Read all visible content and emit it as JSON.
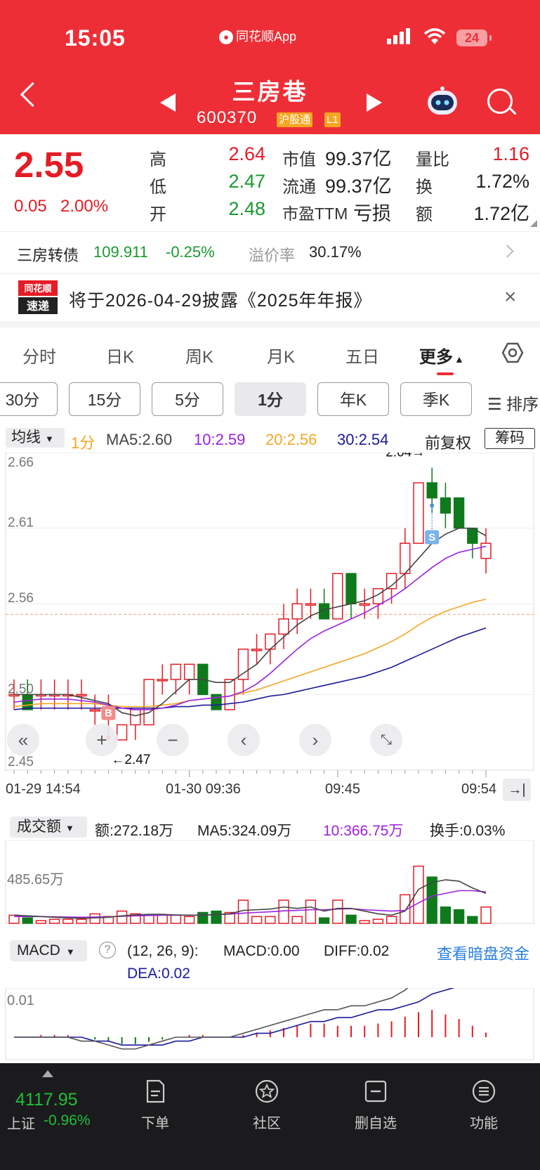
{
  "status": {
    "time": "15:05",
    "app": "同花顺App",
    "battery": "24"
  },
  "stock": {
    "name": "三房巷",
    "code": "600370",
    "tag_market": "沪股通",
    "tag_level": "L1"
  },
  "quote": {
    "price": "2.55",
    "change": "0.05",
    "change_pct": "2.00%",
    "high_label": "高",
    "high": "2.64",
    "low_label": "低",
    "low": "2.47",
    "open_label": "开",
    "open": "2.48",
    "mktcap_label": "市值",
    "mktcap": "99.37亿",
    "float_label": "流通",
    "float": "99.37亿",
    "pe_label": "市盈TTM",
    "pe": "亏损",
    "volratio_label": "量比",
    "volratio": "1.16",
    "turnover_label": "换",
    "turnover": "1.72%",
    "amount_label": "额",
    "amount": "1.72亿"
  },
  "bond": {
    "name": "三房转债",
    "price": "109.911",
    "change": "-0.25%",
    "premium_label": "溢价率",
    "premium": "30.17%"
  },
  "notice": {
    "logo_top": "同花顺",
    "logo_bottom": "速递",
    "text": "将于2026-04-29披露《2025年年报》"
  },
  "tabs": [
    "分时",
    "日K",
    "周K",
    "月K",
    "五日",
    "更多"
  ],
  "periods": [
    "30分",
    "15分",
    "5分",
    "1分",
    "年K",
    "季K"
  ],
  "sort_label": "☰ 排序",
  "ma_row": {
    "selector": "均线",
    "period": "1分",
    "ma5": "MA5:2.60",
    "ma10": "10:2.59",
    "ma20": "20:2.56",
    "ma30": "30:2.54",
    "fq": "前复权",
    "chouma": "筹码"
  },
  "price_axis": [
    "2.66",
    "2.61",
    "2.56",
    "2.50",
    "2.45"
  ],
  "annotations": {
    "high": "2.64→",
    "low": "←2.47",
    "buy": "B",
    "sell": "S"
  },
  "time_axis": [
    "01-29 14:54",
    "01-30 09:36",
    "09:45",
    "09:54"
  ],
  "volume": {
    "selector": "成交额",
    "amount": "额:272.18万",
    "ma5": "MA5:324.09万",
    "ma10": "10:366.75万",
    "turnover": "换手:0.03%",
    "axis_label": "485.65万"
  },
  "macd": {
    "selector": "MACD",
    "params": "(12, 26, 9):",
    "macd": "MACD:0.00",
    "diff": "DIFF:0.02",
    "dea": "DEA:0.02",
    "link": "查看暗盘资金",
    "axis_label": "0.01"
  },
  "bottom": {
    "index_value": "4117.95",
    "index_name": "上证",
    "index_pct": "-0.96%",
    "items": [
      "下单",
      "社区",
      "删自选",
      "功能"
    ]
  },
  "colors": {
    "up": "#e41c25",
    "down": "#0f7a1c",
    "ma5": "#444444",
    "ma10": "#9b22e0",
    "ma20": "#f5a623",
    "ma30": "#1a1a9a",
    "header": "#ee2e36"
  },
  "chart_data": {
    "type": "candlestick",
    "price_range": [
      2.45,
      2.66
    ],
    "candles": [
      {
        "o": 2.5,
        "c": 2.5,
        "h": 2.51,
        "l": 2.49
      },
      {
        "o": 2.5,
        "c": 2.49,
        "h": 2.51,
        "l": 2.49
      },
      {
        "o": 2.5,
        "c": 2.5,
        "h": 2.51,
        "l": 2.49
      },
      {
        "o": 2.5,
        "c": 2.5,
        "h": 2.51,
        "l": 2.49
      },
      {
        "o": 2.5,
        "c": 2.5,
        "h": 2.51,
        "l": 2.49
      },
      {
        "o": 2.5,
        "c": 2.5,
        "h": 2.51,
        "l": 2.49
      },
      {
        "o": 2.49,
        "c": 2.49,
        "h": 2.5,
        "l": 2.48
      },
      {
        "o": 2.49,
        "c": 2.49,
        "h": 2.5,
        "l": 2.47
      },
      {
        "o": 2.47,
        "c": 2.48,
        "h": 2.48,
        "l": 2.47
      },
      {
        "o": 2.48,
        "c": 2.49,
        "h": 2.49,
        "l": 2.47
      },
      {
        "o": 2.48,
        "c": 2.51,
        "h": 2.51,
        "l": 2.48
      },
      {
        "o": 2.51,
        "c": 2.51,
        "h": 2.52,
        "l": 2.5
      },
      {
        "o": 2.51,
        "c": 2.52,
        "h": 2.52,
        "l": 2.5
      },
      {
        "o": 2.51,
        "c": 2.52,
        "h": 2.52,
        "l": 2.5
      },
      {
        "o": 2.52,
        "c": 2.5,
        "h": 2.52,
        "l": 2.5
      },
      {
        "o": 2.5,
        "c": 2.49,
        "h": 2.5,
        "l": 2.49
      },
      {
        "o": 2.49,
        "c": 2.51,
        "h": 2.51,
        "l": 2.49
      },
      {
        "o": 2.51,
        "c": 2.53,
        "h": 2.53,
        "l": 2.5
      },
      {
        "o": 2.53,
        "c": 2.53,
        "h": 2.54,
        "l": 2.52
      },
      {
        "o": 2.53,
        "c": 2.54,
        "h": 2.54,
        "l": 2.52
      },
      {
        "o": 2.54,
        "c": 2.55,
        "h": 2.56,
        "l": 2.53
      },
      {
        "o": 2.55,
        "c": 2.56,
        "h": 2.57,
        "l": 2.54
      },
      {
        "o": 2.56,
        "c": 2.56,
        "h": 2.57,
        "l": 2.55
      },
      {
        "o": 2.56,
        "c": 2.55,
        "h": 2.57,
        "l": 2.55
      },
      {
        "o": 2.55,
        "c": 2.58,
        "h": 2.58,
        "l": 2.55
      },
      {
        "o": 2.58,
        "c": 2.56,
        "h": 2.58,
        "l": 2.55
      },
      {
        "o": 2.56,
        "c": 2.56,
        "h": 2.57,
        "l": 2.55
      },
      {
        "o": 2.56,
        "c": 2.57,
        "h": 2.57,
        "l": 2.55
      },
      {
        "o": 2.57,
        "c": 2.58,
        "h": 2.58,
        "l": 2.56
      },
      {
        "o": 2.58,
        "c": 2.6,
        "h": 2.61,
        "l": 2.57
      },
      {
        "o": 2.6,
        "c": 2.64,
        "h": 2.64,
        "l": 2.6
      },
      {
        "o": 2.64,
        "c": 2.63,
        "h": 2.65,
        "l": 2.62
      },
      {
        "o": 2.63,
        "c": 2.62,
        "h": 2.64,
        "l": 2.61
      },
      {
        "o": 2.63,
        "c": 2.61,
        "h": 2.63,
        "l": 2.61
      },
      {
        "o": 2.61,
        "c": 2.6,
        "h": 2.61,
        "l": 2.59
      },
      {
        "o": 2.59,
        "c": 2.6,
        "h": 2.61,
        "l": 2.58
      }
    ],
    "ma5": [
      2.5,
      2.5,
      2.5,
      2.5,
      2.5,
      2.498,
      2.496,
      2.494,
      2.488,
      2.486,
      2.488,
      2.494,
      2.502,
      2.51,
      2.51,
      2.508,
      2.508,
      2.514,
      2.52,
      2.53,
      2.538,
      2.546,
      2.552,
      2.556,
      2.558,
      2.56,
      2.562,
      2.566,
      2.572,
      2.58,
      2.59,
      2.6,
      2.606,
      2.61,
      2.61,
      2.605
    ],
    "ma10": [
      2.495,
      2.496,
      2.497,
      2.497,
      2.497,
      2.496,
      2.495,
      2.493,
      2.491,
      2.49,
      2.49,
      2.491,
      2.493,
      2.496,
      2.497,
      2.498,
      2.499,
      2.502,
      2.507,
      2.514,
      2.522,
      2.53,
      2.537,
      2.542,
      2.546,
      2.55,
      2.554,
      2.559,
      2.564,
      2.57,
      2.577,
      2.584,
      2.59,
      2.594,
      2.596,
      2.598
    ],
    "ma20": [
      2.492,
      2.493,
      2.494,
      2.494,
      2.494,
      2.494,
      2.494,
      2.493,
      2.492,
      2.492,
      2.492,
      2.493,
      2.494,
      2.496,
      2.497,
      2.498,
      2.499,
      2.501,
      2.503,
      2.506,
      2.509,
      2.512,
      2.515,
      2.518,
      2.521,
      2.524,
      2.527,
      2.531,
      2.535,
      2.54,
      2.546,
      2.551,
      2.555,
      2.558,
      2.561,
      2.563
    ],
    "ma30": [
      2.49,
      2.491,
      2.491,
      2.491,
      2.491,
      2.491,
      2.491,
      2.491,
      2.491,
      2.491,
      2.491,
      2.491,
      2.492,
      2.492,
      2.493,
      2.493,
      2.494,
      2.495,
      2.497,
      2.499,
      2.5,
      2.502,
      2.504,
      2.506,
      2.508,
      2.51,
      2.512,
      2.515,
      2.518,
      2.522,
      2.526,
      2.53,
      2.534,
      2.538,
      2.541,
      2.544
    ],
    "volume": [
      60,
      40,
      20,
      30,
      30,
      30,
      70,
      50,
      90,
      70,
      60,
      60,
      60,
      50,
      80,
      90,
      80,
      170,
      50,
      50,
      170,
      50,
      170,
      40,
      170,
      60,
      20,
      30,
      50,
      210,
      420,
      340,
      120,
      100,
      50,
      120
    ],
    "volume_ma5": [
      60,
      55,
      50,
      45,
      40,
      38,
      40,
      45,
      55,
      62,
      66,
      66,
      62,
      60,
      60,
      65,
      70,
      95,
      100,
      105,
      120,
      110,
      120,
      90,
      110,
      110,
      90,
      70,
      60,
      90,
      250,
      300,
      320,
      310,
      260,
      220
    ],
    "volume_ma10": [
      50,
      50,
      50,
      48,
      46,
      45,
      46,
      48,
      52,
      55,
      58,
      60,
      60,
      60,
      62,
      65,
      68,
      75,
      80,
      85,
      92,
      95,
      100,
      100,
      105,
      108,
      100,
      95,
      90,
      95,
      150,
      200,
      220,
      240,
      240,
      230
    ],
    "volume_axis_max": 485.65,
    "macd_hist": [
      0.0,
      0.0,
      0.001,
      0.001,
      0.001,
      0.0,
      -0.001,
      -0.002,
      -0.003,
      -0.003,
      -0.002,
      -0.001,
      0.0,
      0.001,
      0.001,
      0.0,
      0.0,
      0.001,
      0.002,
      0.003,
      0.004,
      0.005,
      0.006,
      0.006,
      0.005,
      0.005,
      0.005,
      0.006,
      0.007,
      0.009,
      0.011,
      0.012,
      0.01,
      0.008,
      0.005,
      0.002
    ],
    "macd_diff": [
      0.0,
      0.0,
      0.0,
      0.0,
      0.0,
      -0.001,
      -0.001,
      -0.002,
      -0.003,
      -0.003,
      -0.002,
      -0.001,
      0.0,
      0.0,
      0.0,
      0.0,
      0.0,
      0.001,
      0.002,
      0.003,
      0.004,
      0.005,
      0.006,
      0.007,
      0.007,
      0.008,
      0.008,
      0.009,
      0.01,
      0.012,
      0.015,
      0.017,
      0.018,
      0.018,
      0.017,
      0.016
    ],
    "macd_dea": [
      0.0,
      0.0,
      0.0,
      0.0,
      0.0,
      0.0,
      -0.001,
      -0.001,
      -0.002,
      -0.002,
      -0.002,
      -0.002,
      -0.001,
      -0.001,
      0.0,
      0.0,
      0.0,
      0.0,
      0.001,
      0.001,
      0.002,
      0.003,
      0.004,
      0.004,
      0.005,
      0.005,
      0.006,
      0.007,
      0.007,
      0.008,
      0.009,
      0.011,
      0.012,
      0.013,
      0.014,
      0.015
    ]
  }
}
